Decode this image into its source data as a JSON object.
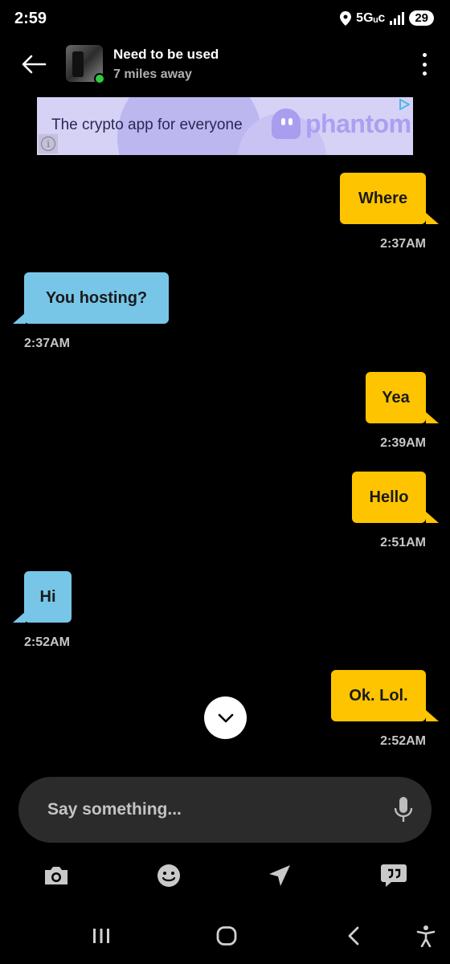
{
  "status_bar": {
    "time": "2:59",
    "network": "5Gᵤᴄ",
    "battery": "29"
  },
  "header": {
    "name": "Need to be used",
    "distance": "7 miles away"
  },
  "ad": {
    "text": "The crypto app for everyone",
    "brand": "phantom",
    "info": "i"
  },
  "messages": [
    {
      "text": "Where",
      "time": "2:37AM",
      "direction": "sent"
    },
    {
      "text": "You hosting?",
      "time": "2:37AM",
      "direction": "received"
    },
    {
      "text": "Yea",
      "time": "2:39AM",
      "direction": "sent"
    },
    {
      "text": "Hello",
      "time": "2:51AM",
      "direction": "sent"
    },
    {
      "text": "Hi",
      "time": "2:52AM",
      "direction": "received"
    },
    {
      "text": "Ok. Lol.",
      "time": "2:52AM",
      "direction": "sent"
    }
  ],
  "composer": {
    "placeholder": "Say something...",
    "value": ""
  },
  "toolbar": {
    "icons": [
      "camera-icon",
      "emoji-icon",
      "location-icon",
      "quick-replies-icon"
    ]
  },
  "navbar": {
    "icons": [
      "recent-apps-icon",
      "home-icon",
      "back-icon",
      "accessibility-icon"
    ]
  },
  "colors": {
    "sent_bubble": "#ffc400",
    "received_bubble": "#77c6e8",
    "background": "#000000",
    "online": "#2ecc40"
  }
}
